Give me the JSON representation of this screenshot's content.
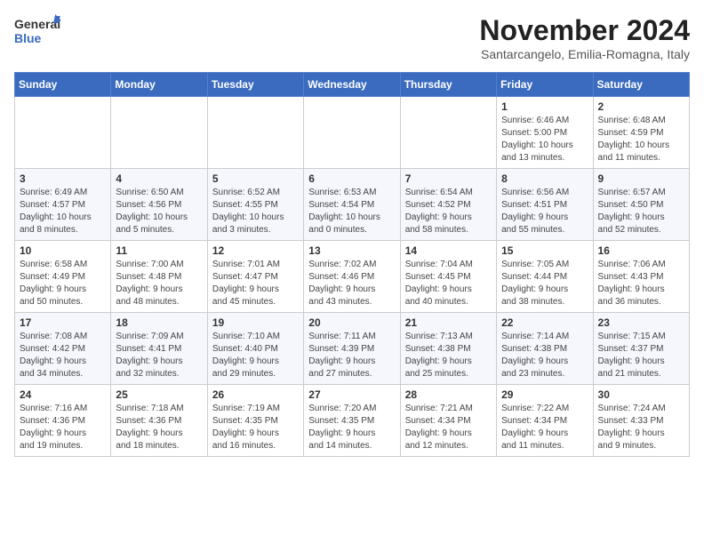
{
  "logo": {
    "line1": "General",
    "line2": "Blue"
  },
  "title": "November 2024",
  "subtitle": "Santarcangelo, Emilia-Romagna, Italy",
  "days_of_week": [
    "Sunday",
    "Monday",
    "Tuesday",
    "Wednesday",
    "Thursday",
    "Friday",
    "Saturday"
  ],
  "weeks": [
    [
      {
        "day": "",
        "info": ""
      },
      {
        "day": "",
        "info": ""
      },
      {
        "day": "",
        "info": ""
      },
      {
        "day": "",
        "info": ""
      },
      {
        "day": "",
        "info": ""
      },
      {
        "day": "1",
        "info": "Sunrise: 6:46 AM\nSunset: 5:00 PM\nDaylight: 10 hours\nand 13 minutes."
      },
      {
        "day": "2",
        "info": "Sunrise: 6:48 AM\nSunset: 4:59 PM\nDaylight: 10 hours\nand 11 minutes."
      }
    ],
    [
      {
        "day": "3",
        "info": "Sunrise: 6:49 AM\nSunset: 4:57 PM\nDaylight: 10 hours\nand 8 minutes."
      },
      {
        "day": "4",
        "info": "Sunrise: 6:50 AM\nSunset: 4:56 PM\nDaylight: 10 hours\nand 5 minutes."
      },
      {
        "day": "5",
        "info": "Sunrise: 6:52 AM\nSunset: 4:55 PM\nDaylight: 10 hours\nand 3 minutes."
      },
      {
        "day": "6",
        "info": "Sunrise: 6:53 AM\nSunset: 4:54 PM\nDaylight: 10 hours\nand 0 minutes."
      },
      {
        "day": "7",
        "info": "Sunrise: 6:54 AM\nSunset: 4:52 PM\nDaylight: 9 hours\nand 58 minutes."
      },
      {
        "day": "8",
        "info": "Sunrise: 6:56 AM\nSunset: 4:51 PM\nDaylight: 9 hours\nand 55 minutes."
      },
      {
        "day": "9",
        "info": "Sunrise: 6:57 AM\nSunset: 4:50 PM\nDaylight: 9 hours\nand 52 minutes."
      }
    ],
    [
      {
        "day": "10",
        "info": "Sunrise: 6:58 AM\nSunset: 4:49 PM\nDaylight: 9 hours\nand 50 minutes."
      },
      {
        "day": "11",
        "info": "Sunrise: 7:00 AM\nSunset: 4:48 PM\nDaylight: 9 hours\nand 48 minutes."
      },
      {
        "day": "12",
        "info": "Sunrise: 7:01 AM\nSunset: 4:47 PM\nDaylight: 9 hours\nand 45 minutes."
      },
      {
        "day": "13",
        "info": "Sunrise: 7:02 AM\nSunset: 4:46 PM\nDaylight: 9 hours\nand 43 minutes."
      },
      {
        "day": "14",
        "info": "Sunrise: 7:04 AM\nSunset: 4:45 PM\nDaylight: 9 hours\nand 40 minutes."
      },
      {
        "day": "15",
        "info": "Sunrise: 7:05 AM\nSunset: 4:44 PM\nDaylight: 9 hours\nand 38 minutes."
      },
      {
        "day": "16",
        "info": "Sunrise: 7:06 AM\nSunset: 4:43 PM\nDaylight: 9 hours\nand 36 minutes."
      }
    ],
    [
      {
        "day": "17",
        "info": "Sunrise: 7:08 AM\nSunset: 4:42 PM\nDaylight: 9 hours\nand 34 minutes."
      },
      {
        "day": "18",
        "info": "Sunrise: 7:09 AM\nSunset: 4:41 PM\nDaylight: 9 hours\nand 32 minutes."
      },
      {
        "day": "19",
        "info": "Sunrise: 7:10 AM\nSunset: 4:40 PM\nDaylight: 9 hours\nand 29 minutes."
      },
      {
        "day": "20",
        "info": "Sunrise: 7:11 AM\nSunset: 4:39 PM\nDaylight: 9 hours\nand 27 minutes."
      },
      {
        "day": "21",
        "info": "Sunrise: 7:13 AM\nSunset: 4:38 PM\nDaylight: 9 hours\nand 25 minutes."
      },
      {
        "day": "22",
        "info": "Sunrise: 7:14 AM\nSunset: 4:38 PM\nDaylight: 9 hours\nand 23 minutes."
      },
      {
        "day": "23",
        "info": "Sunrise: 7:15 AM\nSunset: 4:37 PM\nDaylight: 9 hours\nand 21 minutes."
      }
    ],
    [
      {
        "day": "24",
        "info": "Sunrise: 7:16 AM\nSunset: 4:36 PM\nDaylight: 9 hours\nand 19 minutes."
      },
      {
        "day": "25",
        "info": "Sunrise: 7:18 AM\nSunset: 4:36 PM\nDaylight: 9 hours\nand 18 minutes."
      },
      {
        "day": "26",
        "info": "Sunrise: 7:19 AM\nSunset: 4:35 PM\nDaylight: 9 hours\nand 16 minutes."
      },
      {
        "day": "27",
        "info": "Sunrise: 7:20 AM\nSunset: 4:35 PM\nDaylight: 9 hours\nand 14 minutes."
      },
      {
        "day": "28",
        "info": "Sunrise: 7:21 AM\nSunset: 4:34 PM\nDaylight: 9 hours\nand 12 minutes."
      },
      {
        "day": "29",
        "info": "Sunrise: 7:22 AM\nSunset: 4:34 PM\nDaylight: 9 hours\nand 11 minutes."
      },
      {
        "day": "30",
        "info": "Sunrise: 7:24 AM\nSunset: 4:33 PM\nDaylight: 9 hours\nand 9 minutes."
      }
    ]
  ]
}
